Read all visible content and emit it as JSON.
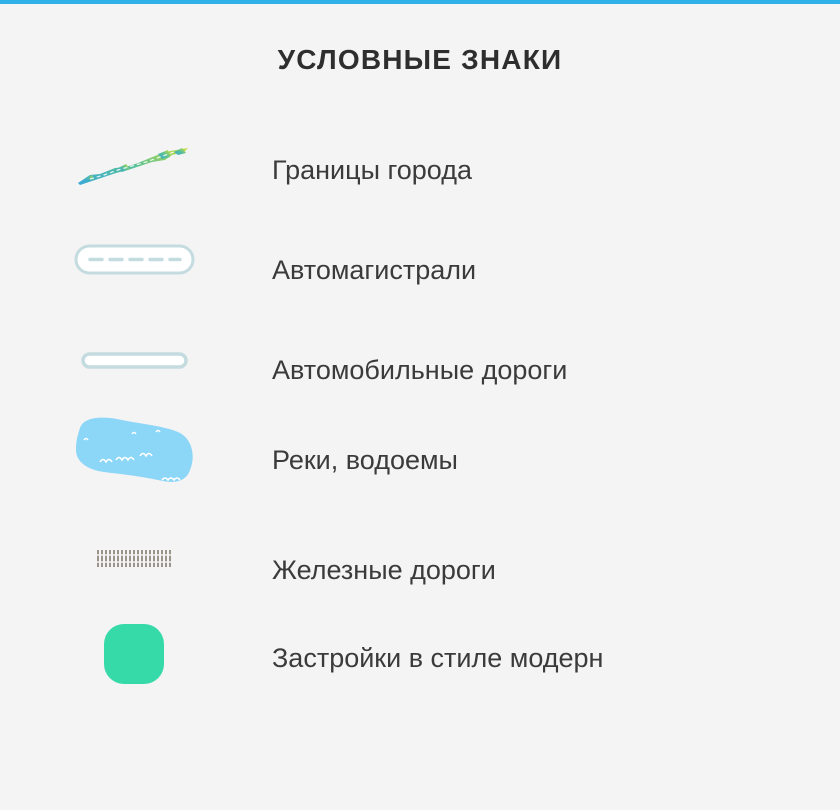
{
  "legend": {
    "title": "УСЛОВНЫЕ ЗНАКИ",
    "items": [
      {
        "label": "Границы города",
        "icon": "city-boundary-icon"
      },
      {
        "label": "Автомагистрали",
        "icon": "highway-icon"
      },
      {
        "label": "Автомобильные дороги",
        "icon": "road-icon"
      },
      {
        "label": "Реки, водоемы",
        "icon": "water-icon"
      },
      {
        "label": "Железные дороги",
        "icon": "railway-icon"
      },
      {
        "label": "Застройки в стиле модерн",
        "icon": "modern-building-icon"
      }
    ]
  },
  "colors": {
    "accent_bar": "#2fb0e6",
    "boundary_start": "#3aa8d8",
    "boundary_end": "#c4dd3a",
    "road_outline": "#c4dcdf",
    "water": "#8cd6f8",
    "railway": "#9a948a",
    "modern_building": "#36d9a8"
  }
}
